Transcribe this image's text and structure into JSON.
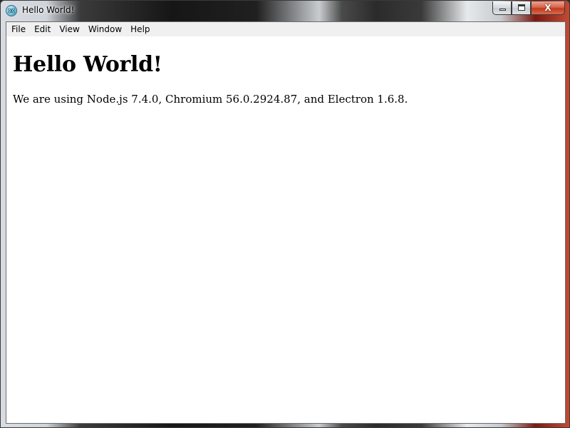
{
  "window": {
    "title": "Hello World!",
    "icon": "electron-app-icon",
    "controls": {
      "minimize": "minimize-icon",
      "maximize": "maximize-icon",
      "close": "close-icon",
      "close_glyph": "X"
    }
  },
  "menubar": {
    "items": [
      {
        "label": "File"
      },
      {
        "label": "Edit"
      },
      {
        "label": "View"
      },
      {
        "label": "Window"
      },
      {
        "label": "Help"
      }
    ]
  },
  "content": {
    "heading": "Hello World!",
    "paragraph": "We are using Node.js 7.4.0, Chromium 56.0.2924.87, and Electron 1.6.8."
  },
  "colors": {
    "close_button": "#c23b1d",
    "menubar_bg": "#f0f0f0",
    "content_bg": "#ffffff"
  }
}
